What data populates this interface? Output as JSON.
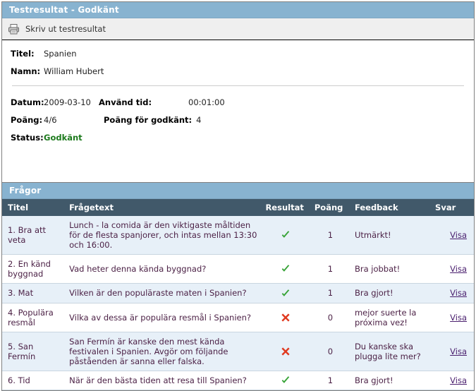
{
  "result_panel": {
    "title": "Testresultat - Godkänt",
    "toolbar": {
      "print_label": "Skriv ut testresultat",
      "print_icon": "printer-icon"
    },
    "fields": {
      "titel_label": "Titel:",
      "titel_value": "Spanien",
      "namn_label": "Namn:",
      "namn_value": "William Hubert",
      "datum_label": "Datum:",
      "datum_value": "2009-03-10",
      "used_time_label": "Använd tid:",
      "used_time_value": "00:01:00",
      "poang_label": "Poäng:",
      "poang_value": "4/6",
      "pass_score_label": "Poäng för godkänt:",
      "pass_score_value": "4",
      "status_label": "Status:",
      "status_value": "Godkänt"
    }
  },
  "questions_panel": {
    "title": "Frågor",
    "columns": {
      "titel": "Titel",
      "fragetext": "Frågetext",
      "resultat": "Resultat",
      "poang": "Poäng",
      "feedback": "Feedback",
      "svar": "Svar"
    },
    "rows": [
      {
        "titel": "1. Bra att veta",
        "fragetext": "Lunch - la comida är den viktigaste måltiden för de flesta spanjorer, och intas mellan 13:30 och 16:00.",
        "resultat": "correct",
        "poang": "1",
        "feedback": "Utmärkt!",
        "svar": "Visa"
      },
      {
        "titel": "2. En känd byggnad",
        "fragetext": "Vad heter denna kända byggnad?",
        "resultat": "correct",
        "poang": "1",
        "feedback": "Bra jobbat!",
        "svar": "Visa"
      },
      {
        "titel": "3. Mat",
        "fragetext": "Vilken är den populäraste maten i Spanien?",
        "resultat": "correct",
        "poang": "1",
        "feedback": "Bra gjort!",
        "svar": "Visa"
      },
      {
        "titel": "4. Populära resmål",
        "fragetext": "Vilka av dessa är populära resmål i Spanien?",
        "resultat": "incorrect",
        "poang": "0",
        "feedback": "mejor suerte la próxima vez!",
        "svar": "Visa"
      },
      {
        "titel": "5. San Fermín",
        "fragetext": "San Fermín är kanske den mest kända festivalen i Spanien. Avgör om följande påståenden är sanna eller falska.",
        "resultat": "incorrect",
        "poang": "0",
        "feedback": "Du kanske ska plugga lite mer?",
        "svar": "Visa"
      },
      {
        "titel": "6. Tid",
        "fragetext": "När är den bästa tiden att resa till Spanien?",
        "resultat": "correct",
        "poang": "1",
        "feedback": "Bra gjort!",
        "svar": "Visa"
      }
    ]
  },
  "colors": {
    "title_bar": "#88b3d0",
    "column_header": "#41596a",
    "row_alt": "#e7f0f8",
    "pass_green": "#1d7a1d",
    "check_green": "#37a337",
    "cross_red": "#e03a20",
    "link_purple": "#4a1f6e"
  }
}
